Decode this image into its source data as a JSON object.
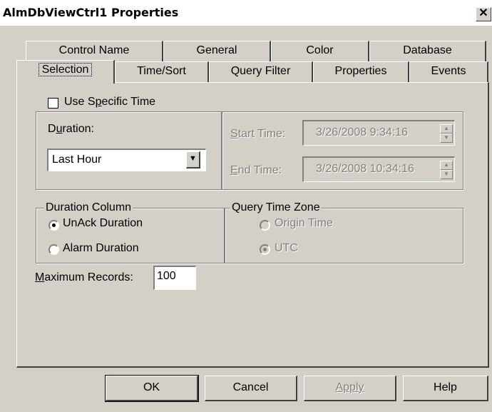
{
  "window": {
    "title": "AlmDbViewCtrl1 Properties",
    "close_glyph": "✕"
  },
  "tabs_back": [
    {
      "label": "Control Name"
    },
    {
      "label": "General"
    },
    {
      "label": "Color"
    },
    {
      "label": "Database"
    }
  ],
  "tabs_front": [
    {
      "label": "Selection"
    },
    {
      "label": "Time/Sort"
    },
    {
      "label": "Query Filter"
    },
    {
      "label": "Properties"
    },
    {
      "label": "Events"
    }
  ],
  "selection": {
    "use_specific_time": {
      "label_pre": "Use S",
      "label_mn": "p",
      "label_post": "ecific Time",
      "checked": false
    },
    "duration": {
      "label_pre": "D",
      "label_mn": "u",
      "label_post": "ration:",
      "value": "Last Hour"
    },
    "start_time": {
      "label_mn": "S",
      "label_post": "tart Time:",
      "value": "3/26/2008  9:34:16"
    },
    "end_time": {
      "label_mn": "E",
      "label_post": "nd Time:",
      "value": "3/26/2008 10:34:16"
    },
    "duration_column": {
      "legend": "Duration Column",
      "options": [
        {
          "label": "UnAck Duration",
          "selected": true
        },
        {
          "label": "Alarm Duration",
          "selected": false
        }
      ]
    },
    "query_time_zone": {
      "legend": "Query Time Zone",
      "options": [
        {
          "label": "Origin Time",
          "selected": false
        },
        {
          "label": "UTC",
          "selected": true
        }
      ]
    },
    "max_records": {
      "label_mn": "M",
      "label_post": "aximum Records:",
      "value": "100"
    }
  },
  "buttons": {
    "ok": "OK",
    "cancel": "Cancel",
    "apply": "Apply",
    "help": "Help"
  }
}
